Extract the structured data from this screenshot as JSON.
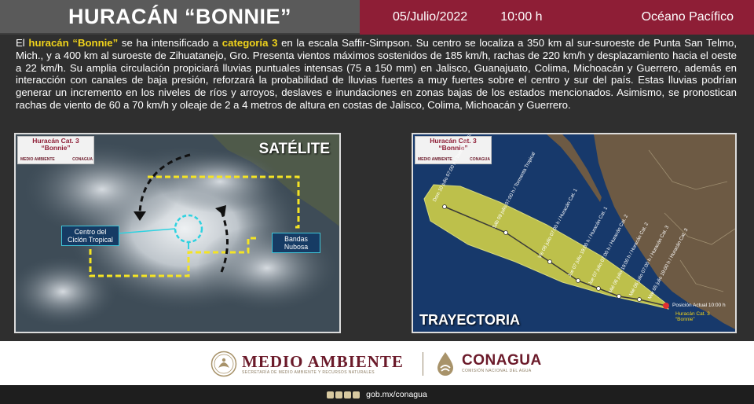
{
  "header": {
    "title": "HURACÁN “BONNIE”",
    "date": "05/Julio/2022",
    "time": "10:00 h",
    "ocean": "Océano Pacífico",
    "colors": {
      "title_bg": "#5a5a5a",
      "info_bg": "#8e1e36",
      "highlight": "#f0d31b"
    }
  },
  "description": {
    "p1": "El ",
    "h1": "huracán “Bonnie”",
    "p2": " se ha intensificado a ",
    "h2": "categoría 3",
    "p3": " en la escala Saffir-Simpson. Su centro se localiza a 350 km al sur-suroeste de Punta San Telmo, Mich., y a 400 km al suroeste de Zihuatanejo, Gro. Presenta vientos máximos sostenidos de 185 km/h, rachas de 220 km/h y desplazamiento hacia el oeste a 22 km/h. Su amplia circulación propiciará lluvias puntuales intensas (75 a 150 mm) en Jalisco, Guanajuato, Colima, Michoacán y Guerrero, además en interacción con canales de baja presión, reforzará la probabilidad de lluvias fuertes a muy fuertes sobre el centro y sur del país. Estas lluvias podrían generar un incremento en los niveles de ríos y arroyos, deslaves e inundaciones en zonas bajas de los estados mencionados. Asimismo, se pronostican rachas de viento de 60 a 70 km/h y oleaje de 2 a 4 metros de altura en costas de Jalisco, Colima, Michoacán y Guerrero."
  },
  "satellite_panel": {
    "badge_title": "Huracán Cat. 3\n“Bonnie”",
    "badge_logo_left": "MEDIO AMBIENTE",
    "badge_logo_right": "CONAGUA",
    "label": "SATÉLITE",
    "center_tag": "Centro del\nCiclón Tropical",
    "bands_tag": "Bandas\nNubosa",
    "icons": [
      "rotation-arrow-icon",
      "eye-circle-icon"
    ]
  },
  "trajectory_panel": {
    "badge_title": "Huracán Cat. 3\n“Bonnie”",
    "badge_logo_left": "MEDIO AMBIENTE",
    "badge_logo_right": "CONAGUA",
    "label": "TRAYECTORIA",
    "current_position": "Posición Actual 10:00 h",
    "current_name": "Huracán Cat. 3\n“Bonnie”",
    "forecast_points": [
      "Dom 10 julio 07:00 h / Tormenta Tropical",
      "Sáb 09 julio 07:00 h / Tormenta Tropical",
      "Vie 08 julio 07:00 h / Huracán Cat. 1",
      "Jue 07 julio 19:00 h / Huracán Cat. 1",
      "Jue 07 julio 07:00 h / Huracán Cat. 2",
      "Mié 06 julio 19:00 h / Huracán Cat. 2",
      "Mié 06 julio 07:00 h / Huracán Cat. 3",
      "Mar 05 julio 19:00 h / Huracán Cat. 3"
    ],
    "colors": {
      "cone": "#c6c84a",
      "ocean": "#17396b",
      "land": "#6d5a44"
    }
  },
  "footer": {
    "logo1_title": "MEDIO AMBIENTE",
    "logo1_sub": "SECRETARÍA DE MEDIO AMBIENTE Y RECURSOS NATURALES",
    "logo2_title": "CONAGUA",
    "logo2_sub": "COMISIÓN NACIONAL DEL AGUA",
    "website": "gob.mx/conagua",
    "social_icons": [
      "facebook-icon",
      "twitter-icon",
      "youtube-icon",
      "instagram-icon"
    ]
  }
}
